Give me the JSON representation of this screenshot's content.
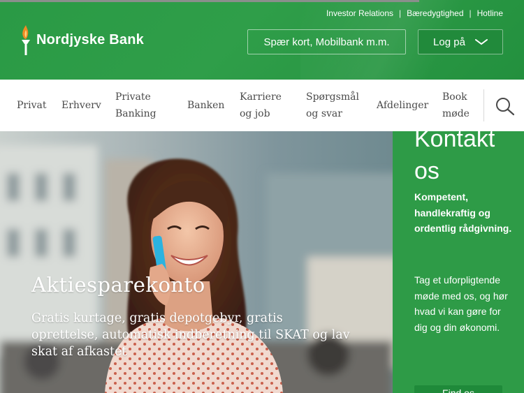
{
  "header": {
    "utility_links": [
      "Investor Relations",
      "Bæredygtighed",
      "Hotline"
    ],
    "logo_text": "Nordjyske Bank",
    "block_button": "Spær kort, Mobilbank m.m.",
    "login_button": "Log på"
  },
  "nav": {
    "items": [
      {
        "line1": "Privat",
        "line2": ""
      },
      {
        "line1": "Erhverv",
        "line2": ""
      },
      {
        "line1": "Private",
        "line2": "Banking"
      },
      {
        "line1": "Banken",
        "line2": ""
      },
      {
        "line1": "Karriere",
        "line2": "og job"
      },
      {
        "line1": "Spørgsmål",
        "line2": "og svar"
      },
      {
        "line1": "Afdelinger",
        "line2": ""
      },
      {
        "line1": "Book",
        "line2": "møde"
      }
    ]
  },
  "hero": {
    "title": "Aktiesparekonto",
    "subtitle": "Gratis kurtage, gratis depotgebyr, gratis oprettelse, automatisk indberetning til SKAT og lav skat af afkastet"
  },
  "contact": {
    "title": "Kontakt os",
    "lead": "Kompetent, handlekraftig og ordentlig rådgivning.",
    "body": "Tag et uforpligtende møde med os, og hør hvad vi kan gøre for dig og din økonomi.",
    "cta": "Find os"
  },
  "colors": {
    "brand_green": "#2e9b47",
    "brand_green_dark": "#218a3b"
  }
}
